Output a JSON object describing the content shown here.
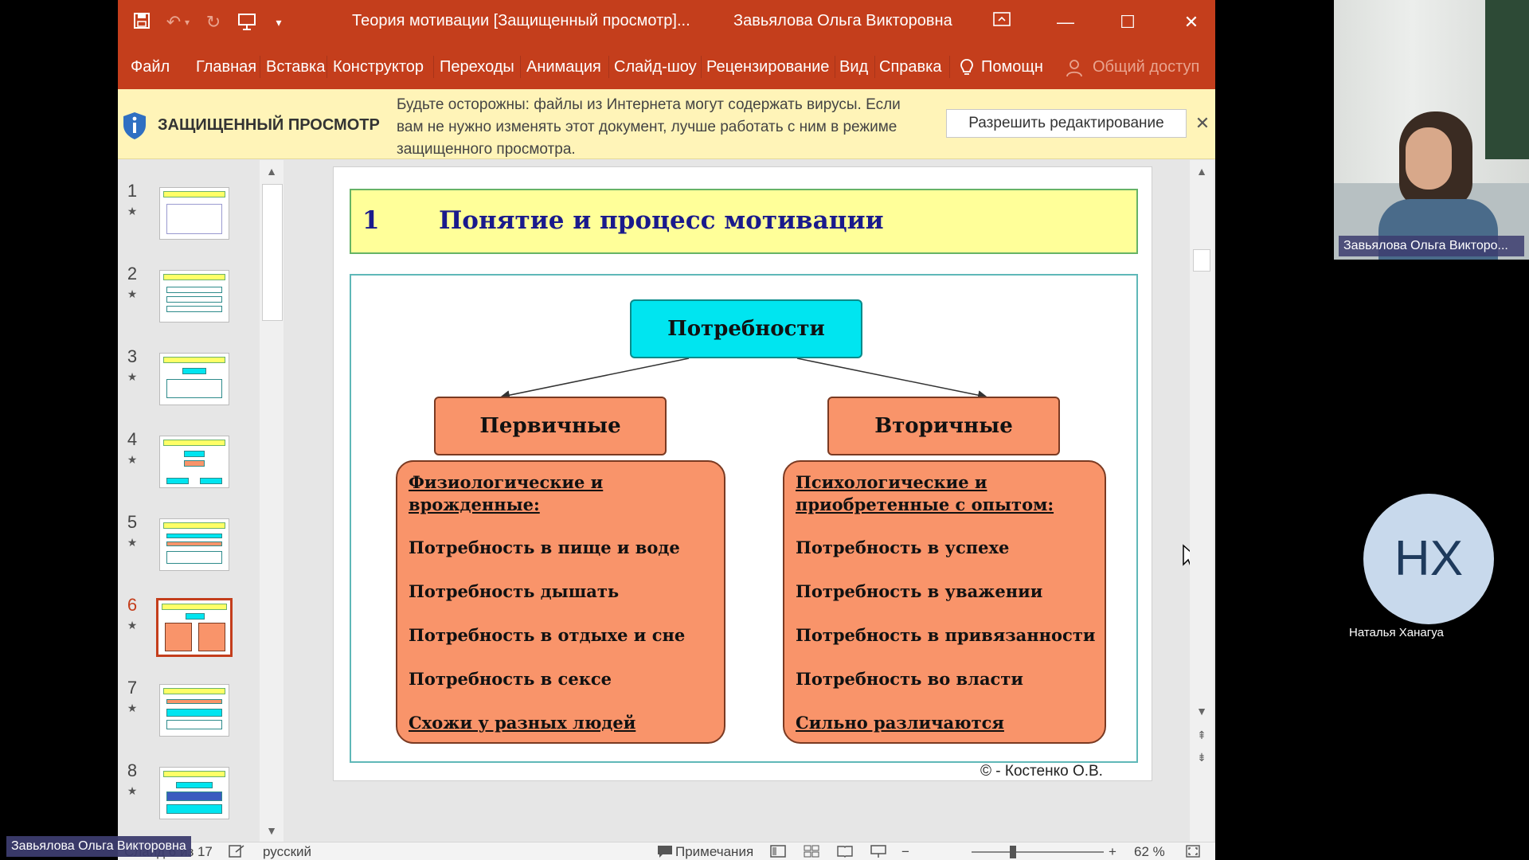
{
  "window": {
    "title": "Теория мотивации [Защищенный просмотр]...",
    "user": "Завьялова Ольга Викторовна"
  },
  "ribbon": {
    "tabs": [
      "Файл",
      "Главная",
      "Вставка",
      "Конструктор",
      "Переходы",
      "Анимация",
      "Слайд-шоу",
      "Рецензирование",
      "Вид",
      "Справка"
    ],
    "help": "Помощн",
    "share": "Общий доступ"
  },
  "protected_view": {
    "title": "ЗАЩИЩЕННЫЙ ПРОСМОТР",
    "message": "Будьте осторожны: файлы из Интернета могут содержать вирусы. Если вам не нужно изменять этот документ, лучше работать с ним в режиме защищенного просмотра.",
    "enable_button": "Разрешить редактирование"
  },
  "thumbnails": {
    "numbers": [
      "1",
      "2",
      "3",
      "4",
      "5",
      "6",
      "7",
      "8"
    ],
    "active": "6",
    "star": "★"
  },
  "slide": {
    "number": "1",
    "title": "Понятие и процесс мотивации",
    "root": "Потребности",
    "left_box": "Первичные",
    "right_box": "Вторичные",
    "left_list": {
      "head": "Физиологические и врожденные:",
      "items": [
        "Потребность в пище и воде",
        "Потребность дышать",
        "Потребность в отдыхе и сне",
        "Потребность в сексе"
      ],
      "foot": "Схожи у разных людей"
    },
    "right_list": {
      "head": "Психологические и приобретенные с опытом:",
      "items": [
        "Потребность в успехе",
        "Потребность в уважении",
        "Потребность в привязанности",
        "Потребность во власти"
      ],
      "foot": "Сильно различаются"
    },
    "copyright": "© - Костенко О.В."
  },
  "statusbar": {
    "slide_info": "Слайд 6 из 17",
    "language": "русский",
    "notes": "Примечания",
    "zoom": "62 %"
  },
  "participants": {
    "video_name": "Завьялова Ольга Викторо...",
    "avatar_initials": "НХ",
    "avatar_name": "Наталья Ханагуа",
    "speaker_label": "Завьялова Ольга Викторовна"
  },
  "colors": {
    "accent": "#c43e1c",
    "title_band": "#ffff99",
    "root_box": "#00e5f0",
    "branch_box": "#f9946a"
  }
}
